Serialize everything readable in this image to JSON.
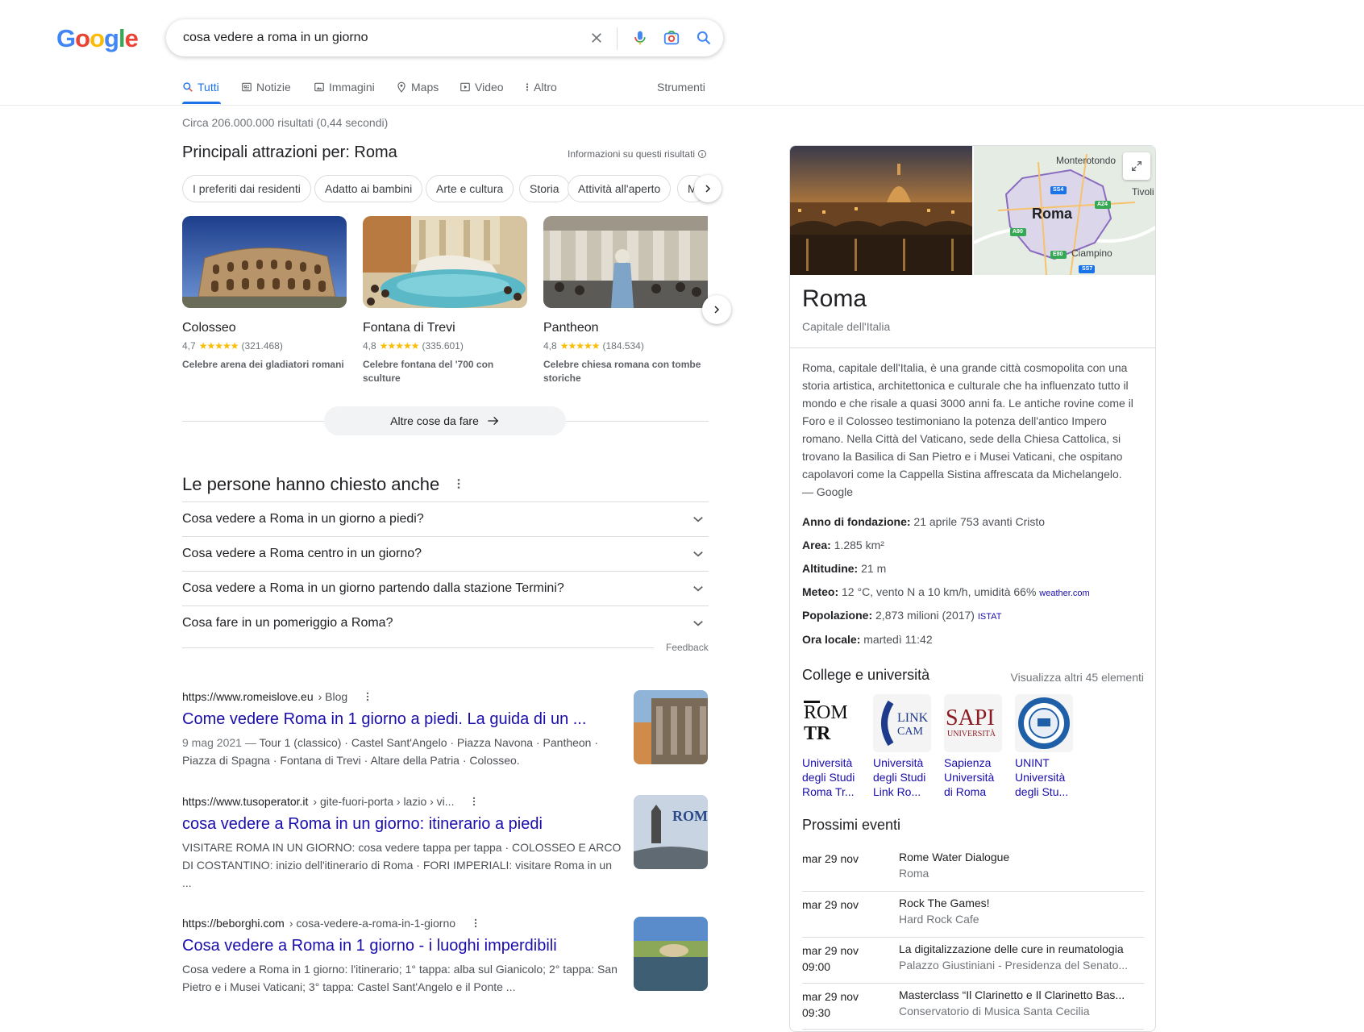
{
  "logo": [
    "G",
    "o",
    "o",
    "g",
    "l",
    "e"
  ],
  "search": {
    "query": "cosa vedere a roma in un giorno"
  },
  "tabs": [
    {
      "label": "Tutti",
      "icon": "search-icon",
      "active": true
    },
    {
      "label": "Notizie",
      "icon": "news-icon"
    },
    {
      "label": "Immagini",
      "icon": "image-icon"
    },
    {
      "label": "Maps",
      "icon": "map-pin-icon"
    },
    {
      "label": "Video",
      "icon": "play-icon"
    },
    {
      "label": "Altro",
      "icon": "more-vertical-icon"
    }
  ],
  "tools_label": "Strumenti",
  "stats": "Circa 206.000.000 risultati (0,44 secondi)",
  "attractions": {
    "heading": "Principali attrazioni per: Roma",
    "info": "Informazioni su questi risultati",
    "chips": [
      "I preferiti dai residenti",
      "Adatto ai bambini",
      "Arte e cultura",
      "Storia",
      "Attività all'aperto",
      "M"
    ],
    "cards": [
      {
        "name": "Colosseo",
        "rating": "4,7",
        "reviews": "(321.468)",
        "desc": "Celebre arena dei gladiatori romani"
      },
      {
        "name": "Fontana di Trevi",
        "rating": "4,8",
        "reviews": "(335.601)",
        "desc": "Celebre fontana del '700 con sculture"
      },
      {
        "name": "Pantheon",
        "rating": "4,8",
        "reviews": "(184.534)",
        "desc": "Celebre chiesa romana con tombe storiche"
      }
    ],
    "more_label": "Altre cose da fare"
  },
  "paa": {
    "heading": "Le persone hanno chiesto anche",
    "questions": [
      "Cosa vedere a Roma in un giorno a piedi?",
      "Cosa vedere a Roma centro in un giorno?",
      "Cosa vedere a Roma in un giorno partendo dalla stazione Termini?",
      "Cosa fare in un pomeriggio a Roma?"
    ],
    "feedback": "Feedback"
  },
  "results": [
    {
      "url": "https://www.romeislove.eu",
      "path": " › Blog",
      "title": "Come vedere Roma in 1 giorno a piedi. La guida di un ...",
      "snippet_date": "9 mag 2021 — ",
      "snippet": "Tour 1 (classico) · Castel Sant'Angelo · Piazza Navona · Pantheon · Piazza di Spagna · Fontana di Trevi · Altare della Patria · Colosseo."
    },
    {
      "url": "https://www.tusoperator.it",
      "path": " › gite-fuori-porta › lazio › vi...",
      "title": "cosa vedere a Roma in un giorno: itinerario a piedi",
      "snippet_date": "",
      "snippet": "VISITARE ROMA IN UN GIORNO: cosa vedere tappa per tappa · COLOSSEO E ARCO DI COSTANTINO: inizio dell'itinerario di Roma · FORI IMPERIALI: visitare Roma in un ..."
    },
    {
      "url": "https://beborghi.com",
      "path": " › cosa-vedere-a-roma-in-1-giorno",
      "title": "Cosa vedere a Roma in 1 giorno - i luoghi imperdibili",
      "snippet_date": "",
      "snippet": "Cosa vedere a Roma in 1 giorno: l'itinerario; 1° tappa: alba sul Gianicolo; 2° tappa: San Pietro e i Musei Vaticani; 3° tappa: Castel Sant'Angelo e il Ponte ..."
    }
  ],
  "knowledge": {
    "map_labels": {
      "city": "Roma",
      "top": "Monterotondo",
      "right": "Tivoli",
      "bottom": "Ciampino",
      "roads": [
        "SS4",
        "A24",
        "A90",
        "E80",
        "SS7"
      ]
    },
    "title": "Roma",
    "subtitle": "Capitale dell'Italia",
    "description": "Roma, capitale dell'Italia, è una grande città cosmopolita con una storia artistica, architettonica e culturale che ha influenzato tutto il mondo e che risale a quasi 3000 anni fa. Le antiche rovine come il Foro e il Colosseo testimoniano la potenza dell'antico Impero romano. Nella Città del Vaticano, sede della Chiesa Cattolica, si trovano la Basilica di San Pietro e i Musei Vaticani, che ospitano capolavori come la Cappella Sistina affrescata da Michelangelo.",
    "description_source": "— Google",
    "facts": [
      {
        "label": "Anno di fondazione:",
        "value": " 21 aprile 753 avanti Cristo",
        "src": ""
      },
      {
        "label": "Area:",
        "value": " 1.285 km²",
        "src": ""
      },
      {
        "label": "Altitudine:",
        "value": " 21 m",
        "src": ""
      },
      {
        "label": "Meteo:",
        "value": " 12 °C, vento N a 10 km/h, umidità 66% ",
        "src": "weather.com"
      },
      {
        "label": "Popolazione:",
        "value": " 2,873 milioni (2017) ",
        "src": "ISTAT"
      },
      {
        "label": "Ora locale:",
        "value": " martedì 11:42",
        "src": ""
      }
    ],
    "colleges_heading": "College e università",
    "colleges_more": "Visualizza altri 45 elementi",
    "colleges": [
      {
        "name": "Università degli Studi Roma Tr...",
        "logo_text": "ROMA TRE"
      },
      {
        "name": "Università degli Studi Link Ro...",
        "logo_text": "LINK CAM"
      },
      {
        "name": "Sapienza Università di Roma",
        "logo_text": "SAPIENZA"
      },
      {
        "name": "UNINT Università degli Stu...",
        "logo_text": "UNINT"
      }
    ],
    "events_heading": "Prossimi eventi",
    "events": [
      {
        "date": "mar 29 nov",
        "time": "",
        "name": "Rome Water Dialogue",
        "place": "Roma"
      },
      {
        "date": "mar 29 nov",
        "time": "",
        "name": "Rock The Games!",
        "place": "Hard Rock Cafe"
      },
      {
        "date": "mar 29 nov",
        "time": "09:00",
        "name": "La digitalizzazione delle cure in reumatologia",
        "place": "Palazzo Giustiniani - Presidenza del Senato..."
      },
      {
        "date": "mar 29 nov",
        "time": "09:30",
        "name": "Masterclass “Il Clarinetto e Il Clarinetto Bas...",
        "place": "Conservatorio di Musica Santa Cecilia"
      }
    ]
  },
  "colors": {
    "link": "#1a0dab",
    "accent": "#1a73e8",
    "star": "#fbbc04"
  }
}
